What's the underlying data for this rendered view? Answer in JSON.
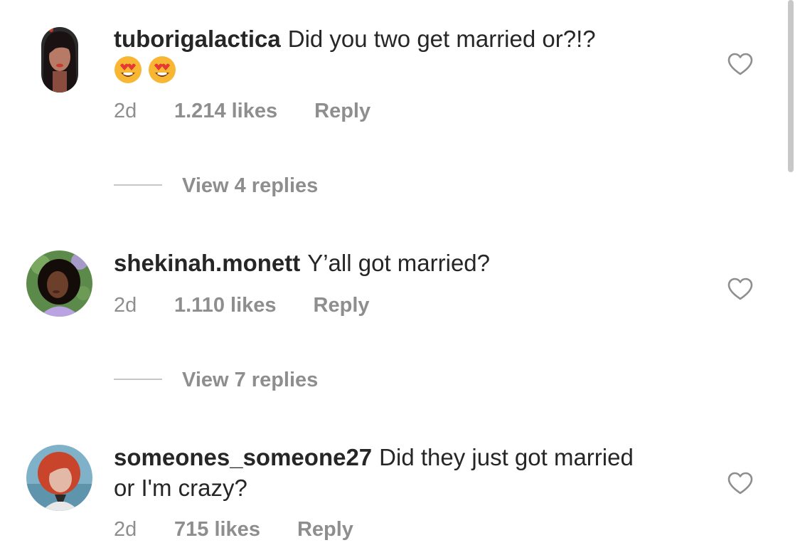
{
  "comments": [
    {
      "username": "tuborigalactica",
      "text": "Did you two get married or?!?",
      "emojis": [
        "heart-eyes-emoji",
        "heart-eyes-emoji"
      ],
      "time": "2d",
      "likes": "1.214 likes",
      "reply_label": "Reply",
      "view_replies": "View 4 replies",
      "avatar_colors": {
        "bg": "#2a2a2a",
        "skin": "#b77a66",
        "hair": "#1a1212",
        "accent": "#c83a2e"
      }
    },
    {
      "username": "shekinah.monett",
      "text": "Y’all got married?",
      "time": "2d",
      "likes": "1.110 likes",
      "reply_label": "Reply",
      "view_replies": "View 7 replies",
      "avatar_colors": {
        "bg": "#5c8a4a",
        "skin": "#6b3f2a",
        "hair": "#140c08",
        "accent": "#b9a3e0"
      }
    },
    {
      "username": "someones_someone27",
      "text": "Did they just got married or I'm crazy?",
      "time": "2d",
      "likes": "715 likes",
      "reply_label": "Reply",
      "avatar_colors": {
        "bg": "#7fb2c9",
        "skin": "#e2b8a6",
        "hair": "#c8442a",
        "accent": "#2a2a2a"
      }
    }
  ],
  "icons": {
    "like": "heart-outline-icon"
  },
  "colors": {
    "text": "#262626",
    "secondary": "#8e8e8e",
    "divider": "#c7c7c7",
    "scrollbar": "#c8c8c8"
  }
}
